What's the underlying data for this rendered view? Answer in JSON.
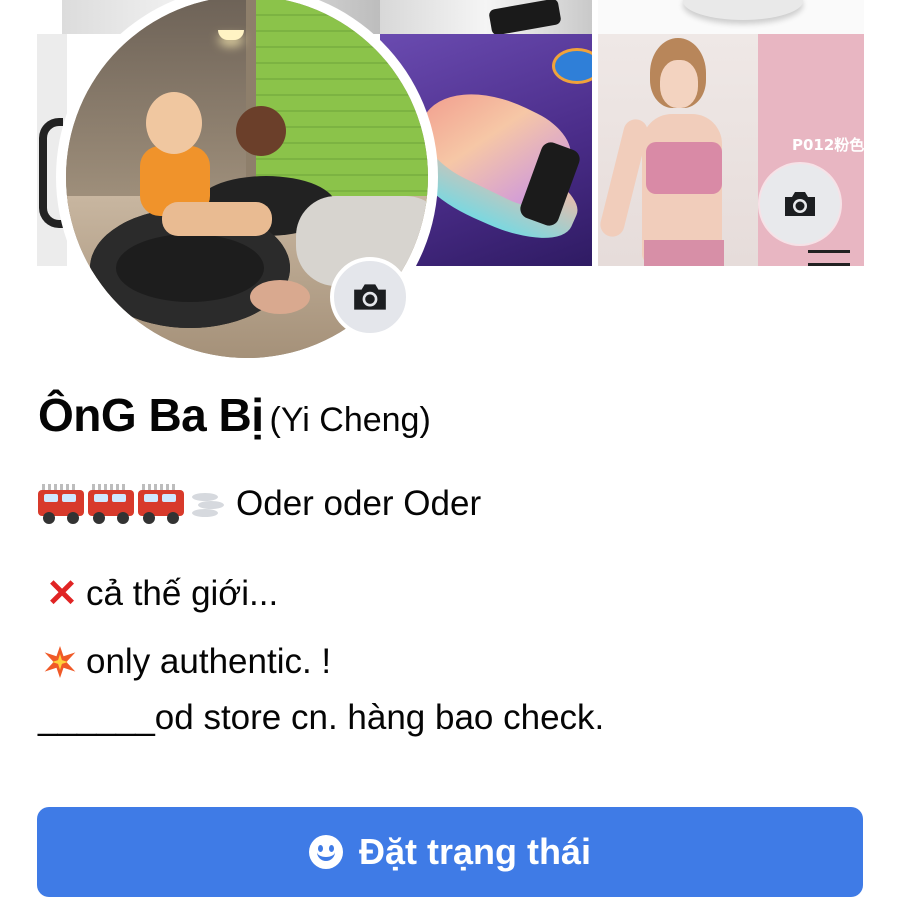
{
  "profile": {
    "name": "ÔnG Ba Bị",
    "alternate_name": "(Yi Cheng)",
    "bio": {
      "line1_text": "Oder oder Oder",
      "line1_emojis": [
        "fire-engine-icon",
        "fire-engine-icon",
        "fire-engine-icon",
        "dash-icon"
      ],
      "line2_text": "cả thế giới...",
      "line2_emoji": "cross-mark-icon",
      "line3_text": "only authentic. !",
      "line3_emoji": "collision-icon",
      "line4_text": "______od store cn. hàng bao check."
    }
  },
  "cover": {
    "product_label": "P012粉色",
    "camera_button_icon": "camera-icon"
  },
  "avatar": {
    "camera_button_icon": "camera-icon"
  },
  "status_button": {
    "label": "Đặt trạng thái",
    "icon": "smiley-icon",
    "background_color": "#3f7be6"
  },
  "cross_glyph": "✕"
}
